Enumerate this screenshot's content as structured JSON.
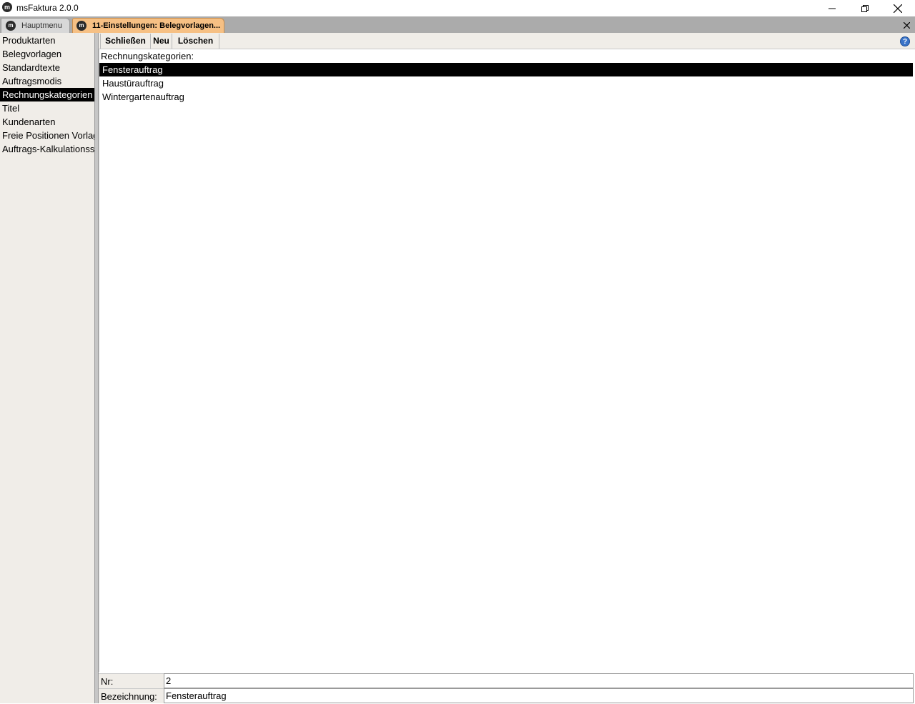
{
  "window": {
    "title": "msFaktura 2.0.0",
    "icon": "m-logo-icon"
  },
  "tabs": [
    {
      "label": "Hauptmenu",
      "active": false
    },
    {
      "label": "11-Einstellungen: Belegvorlagen...",
      "active": true
    }
  ],
  "sidebar": {
    "items": [
      {
        "label": "Produktarten",
        "selected": false
      },
      {
        "label": "Belegvorlagen",
        "selected": false
      },
      {
        "label": "Standardtexte",
        "selected": false
      },
      {
        "label": "Auftragsmodis",
        "selected": false
      },
      {
        "label": "Rechnungskategorien",
        "selected": true
      },
      {
        "label": "Titel",
        "selected": false
      },
      {
        "label": "Kundenarten",
        "selected": false
      },
      {
        "label": "Freie Positionen Vorlagen",
        "selected": false
      },
      {
        "label": "Auftrags-Kalkulationsschema",
        "selected": false
      }
    ]
  },
  "toolbar": {
    "close_label": "Schließen",
    "new_label": "Neu",
    "delete_label": "Löschen"
  },
  "list": {
    "label": "Rechnungskategorien:",
    "rows": [
      {
        "label": "Fensterauftrag",
        "selected": true
      },
      {
        "label": "Haustürauftrag",
        "selected": false
      },
      {
        "label": "Wintergartenauftrag",
        "selected": false
      }
    ]
  },
  "form": {
    "nr_label": "Nr:",
    "nr_value": "2",
    "bezeichnung_label": "Bezeichnung:",
    "bezeichnung_value": "Fensterauftrag"
  },
  "colors": {
    "tab_active": "#f6c084",
    "selection": "#000000",
    "panel": "#f0ede8"
  }
}
